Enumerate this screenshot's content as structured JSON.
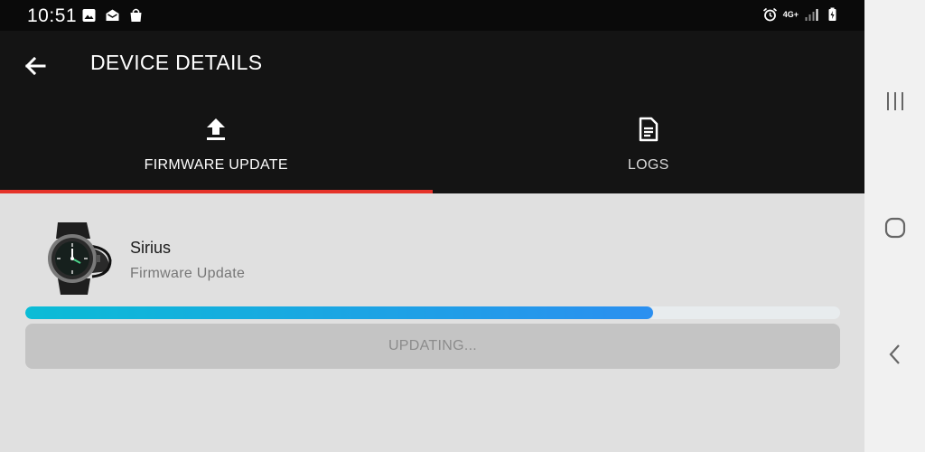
{
  "status_bar": {
    "time": "10:51",
    "left_icons": [
      "gallery-icon",
      "mail-icon",
      "shopping-bag-icon"
    ],
    "right_icons": [
      "alarm-icon",
      "network-4g-icon",
      "signal-icon",
      "battery-charging-icon"
    ],
    "network_type": "4G+"
  },
  "app_bar": {
    "title": "DEVICE DETAILS",
    "back_icon": "arrow-left-icon"
  },
  "tabs": [
    {
      "label": "FIRMWARE UPDATE",
      "icon": "upload-icon",
      "selected": true
    },
    {
      "label": "LOGS",
      "icon": "document-icon",
      "selected": false
    }
  ],
  "accent_color": "#e5332a",
  "device": {
    "name": "Sirius",
    "subtitle": "Firmware Update",
    "image": "smartwatch-image"
  },
  "progress": {
    "fraction": 0.77,
    "gradient_start": "#0bbcd6",
    "gradient_end": "#2b8ff0"
  },
  "action_button": {
    "label": "UPDATING...",
    "enabled": false
  },
  "nav_bar": {
    "buttons": [
      "recent-apps-icon",
      "home-icon",
      "back-icon"
    ]
  }
}
